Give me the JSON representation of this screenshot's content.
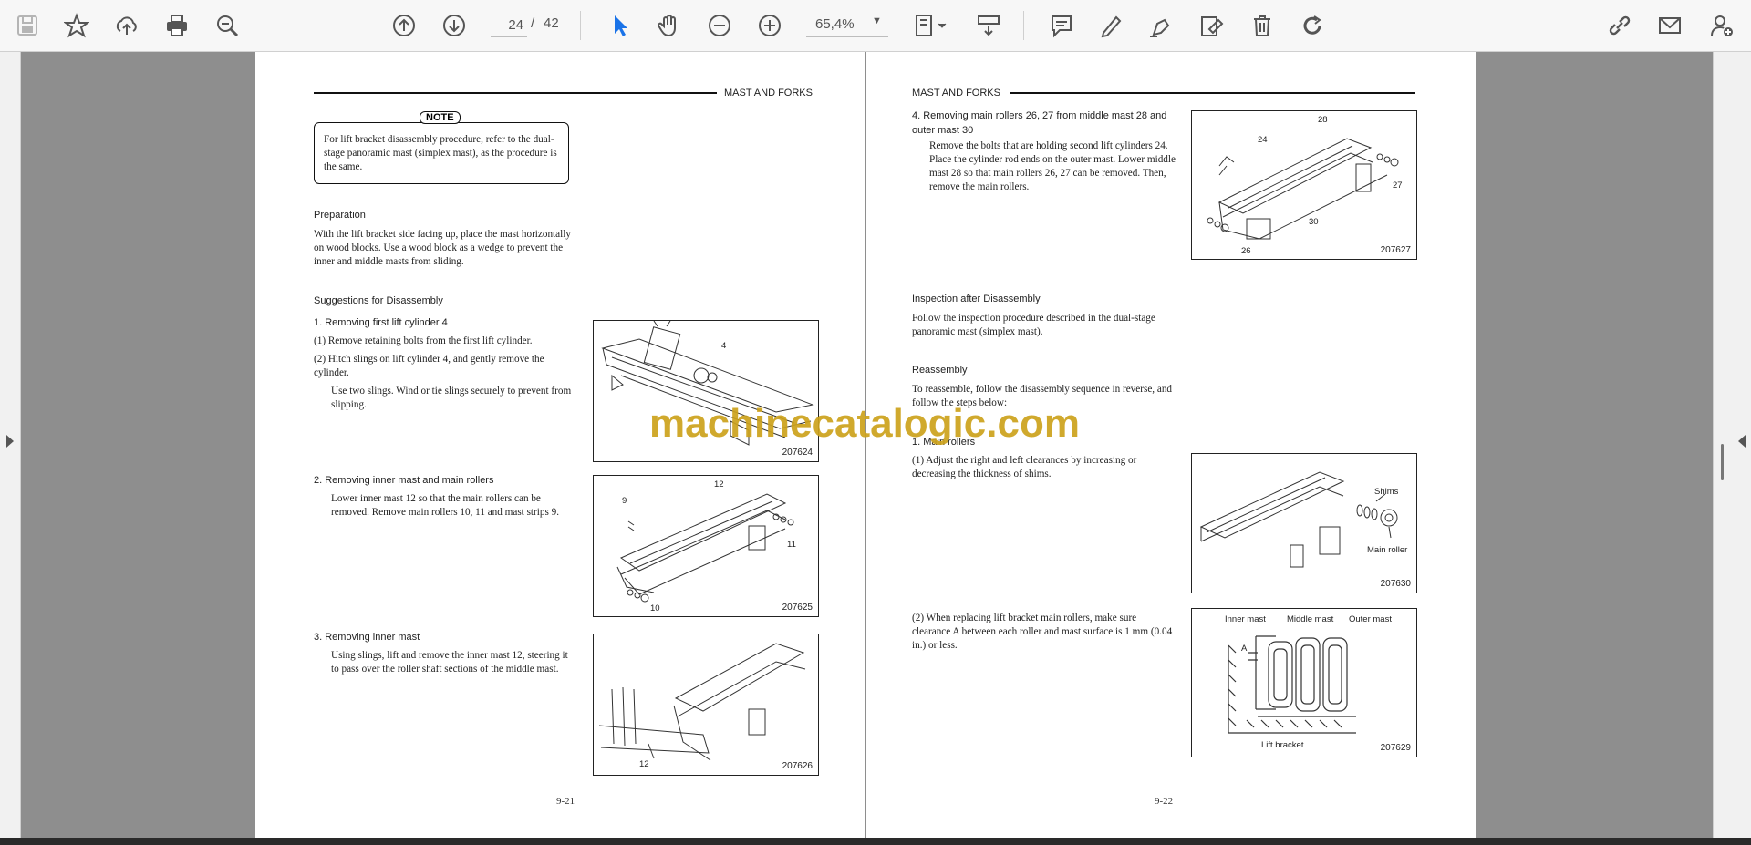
{
  "toolbar": {
    "page_current": "24",
    "page_separator": "/",
    "page_total": "42",
    "zoom": "65,4%"
  },
  "icons": [
    "save-icon",
    "bookmark-star-icon",
    "upload-cloud-icon",
    "print-icon",
    "zoom-search-icon",
    "page-up-icon",
    "page-down-icon",
    "select-cursor-icon",
    "hand-pan-icon",
    "zoom-out-icon",
    "zoom-in-icon",
    "fit-page-icon",
    "scroll-mode-icon",
    "comment-icon",
    "highlight-pen-icon",
    "sign-icon",
    "stamp-icon",
    "delete-icon",
    "rotate-icon",
    "share-link-icon",
    "email-icon",
    "add-user-icon"
  ],
  "colors": {
    "accent": "#1a73e8",
    "watermark": "#cda21c",
    "viewer_bg": "#8e8e8e"
  },
  "watermark": "machinecatalogic.com",
  "left_page": {
    "header": "MAST AND FORKS",
    "note_label": "NOTE",
    "note_text": "For lift bracket disassembly procedure, refer to the dual-stage panoramic mast (simplex mast), as the procedure is the same.",
    "prep_title": "Preparation",
    "prep_text": "With the lift bracket side facing up, place the mast horizontally on wood blocks.  Use a wood block as a wedge to prevent the inner and middle masts from sliding.",
    "sugg_title": "Suggestions for Disassembly",
    "step1_title": "1.   Removing first lift cylinder 4",
    "step1_a": "(1)  Remove retaining bolts from the first lift cylinder.",
    "step1_b": "(2)  Hitch slings on lift cylinder 4, and gently remove the cylinder.",
    "step1_c": "Use two slings.  Wind or tie slings securely to prevent from slipping.",
    "step2_title": "2.   Removing inner mast and main rollers",
    "step2_text": "Lower inner mast 12 so that the main rollers can be removed.  Remove main rollers 10, 11 and mast strips 9.",
    "step3_title": "3.   Removing inner mast",
    "step3_text": "Using slings, lift and remove the inner mast 12, steering it to pass over the roller shaft sections of the middle mast.",
    "fig1_id": "207624",
    "fig1_label_a": "4",
    "fig2_id": "207625",
    "fig2_label_a": "12",
    "fig2_label_b": "9",
    "fig2_label_c": "11",
    "fig2_label_d": "10",
    "fig3_id": "207626",
    "fig3_label_a": "12",
    "page_number": "9-21"
  },
  "right_page": {
    "header": "MAST AND FORKS",
    "step4_title": "4.   Removing main rollers 26, 27 from middle mast 28 and outer mast 30",
    "step4_text": "Remove the bolts that are holding second lift cylinders 24.  Place the cylinder rod ends on the outer mast. Lower middle mast 28 so that main rollers 26, 27 can be removed.  Then, remove the main rollers.",
    "insp_title": "Inspection after Disassembly",
    "insp_text": "Follow the inspection procedure described in the dual-stage panoramic mast (simplex mast).",
    "reasm_title": "Reassembly",
    "reasm_text": "To reassemble, follow the disassembly sequence in reverse, and follow the steps below:",
    "r1_title": "1.   Main rollers",
    "r1_a": "(1)  Adjust the right and left clearances by increasing or decreasing the thickness of shims.",
    "r1_b": "(2)  When replacing lift bracket main rollers, make sure clearance A between each roller and mast surface is 1 mm (0.04 in.) or less.",
    "fig4_id": "207627",
    "fig4_label_a": "28",
    "fig4_label_b": "24",
    "fig4_label_c": "27",
    "fig4_label_d": "30",
    "fig4_label_e": "26",
    "fig5_id": "207630",
    "fig5_label_a": "Shims",
    "fig5_label_b": "Main roller",
    "fig6_id": "207629",
    "fig6_label_a": "Inner mast",
    "fig6_label_b": "Middle mast",
    "fig6_label_c": "Outer mast",
    "fig6_label_d": "A",
    "fig6_label_e": "Lift bracket",
    "page_number": "9-22"
  }
}
